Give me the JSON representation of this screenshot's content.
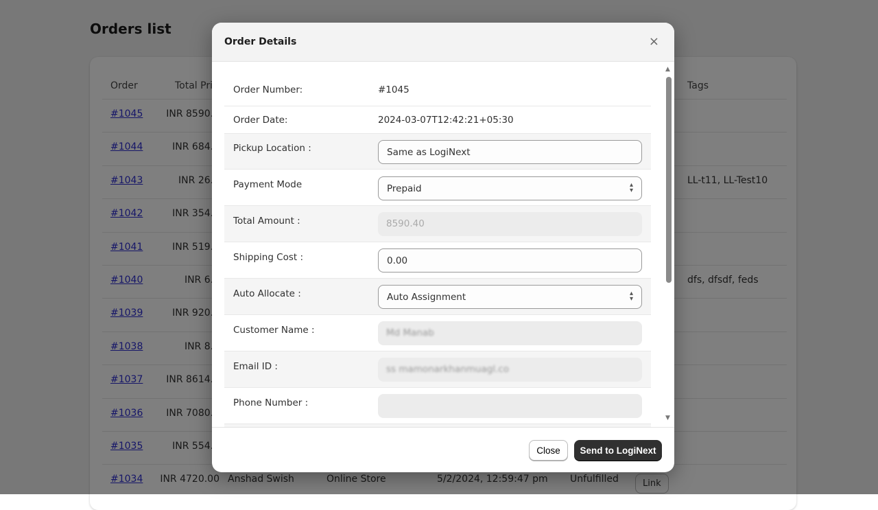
{
  "page": {
    "title": "Orders list"
  },
  "table": {
    "headers": {
      "order": "Order",
      "total": "Total Pric",
      "tags": "Tags"
    },
    "rows": [
      {
        "order": "#1045",
        "total": "INR 8590.4",
        "tags": ""
      },
      {
        "order": "#1044",
        "total": "INR 684.4",
        "tags": ""
      },
      {
        "order": "#1043",
        "total": "INR 26.5",
        "tags": "LL-t11, LL-Test10"
      },
      {
        "order": "#1042",
        "total": "INR 354.0",
        "tags": ""
      },
      {
        "order": "#1041",
        "total": "INR 519.2",
        "tags": ""
      },
      {
        "order": "#1040",
        "total": "INR 6.9",
        "tags": "dfs, dfsdf, feds"
      },
      {
        "order": "#1039",
        "total": "INR 920.4",
        "tags": ""
      },
      {
        "order": "#1038",
        "total": "INR 8.8",
        "tags": ""
      },
      {
        "order": "#1037",
        "total": "INR 8614.0",
        "tags": ""
      },
      {
        "order": "#1036",
        "total": "INR 7080.0",
        "tags": ""
      },
      {
        "order": "#1035",
        "total": "INR 554.6",
        "tags": ""
      },
      {
        "order": "#1034",
        "total": "INR 4720.00",
        "customer": "Anshad Swish",
        "channel": "Online Store",
        "date": "5/2/2024, 12:59:47 pm",
        "status": "Unfulfilled",
        "link": "Link",
        "tags": ""
      }
    ]
  },
  "modal": {
    "title": "Order Details",
    "close_icon": "×",
    "fields": {
      "order_number": {
        "label": "Order Number:",
        "value": "#1045"
      },
      "order_date": {
        "label": "Order Date:",
        "value": "2024-03-07T12:42:21+05:30"
      },
      "pickup": {
        "label": "Pickup Location :",
        "value": "Same as LogiNext"
      },
      "payment": {
        "label": "Payment Mode",
        "value": "Prepaid"
      },
      "total": {
        "label": "Total Amount :",
        "value": "8590.40"
      },
      "shipping": {
        "label": "Shipping Cost :",
        "value": "0.00"
      },
      "auto": {
        "label": "Auto Allocate :",
        "value": "Auto Assignment"
      },
      "customer": {
        "label": "Customer Name :",
        "value": "Md Manab"
      },
      "email": {
        "label": "Email ID :",
        "value": "ss mamonarkhanmuagl.co"
      },
      "phone": {
        "label": "Phone Number :",
        "value": ""
      }
    },
    "close_label": "Close",
    "send_label": "Send to LogiNext"
  }
}
